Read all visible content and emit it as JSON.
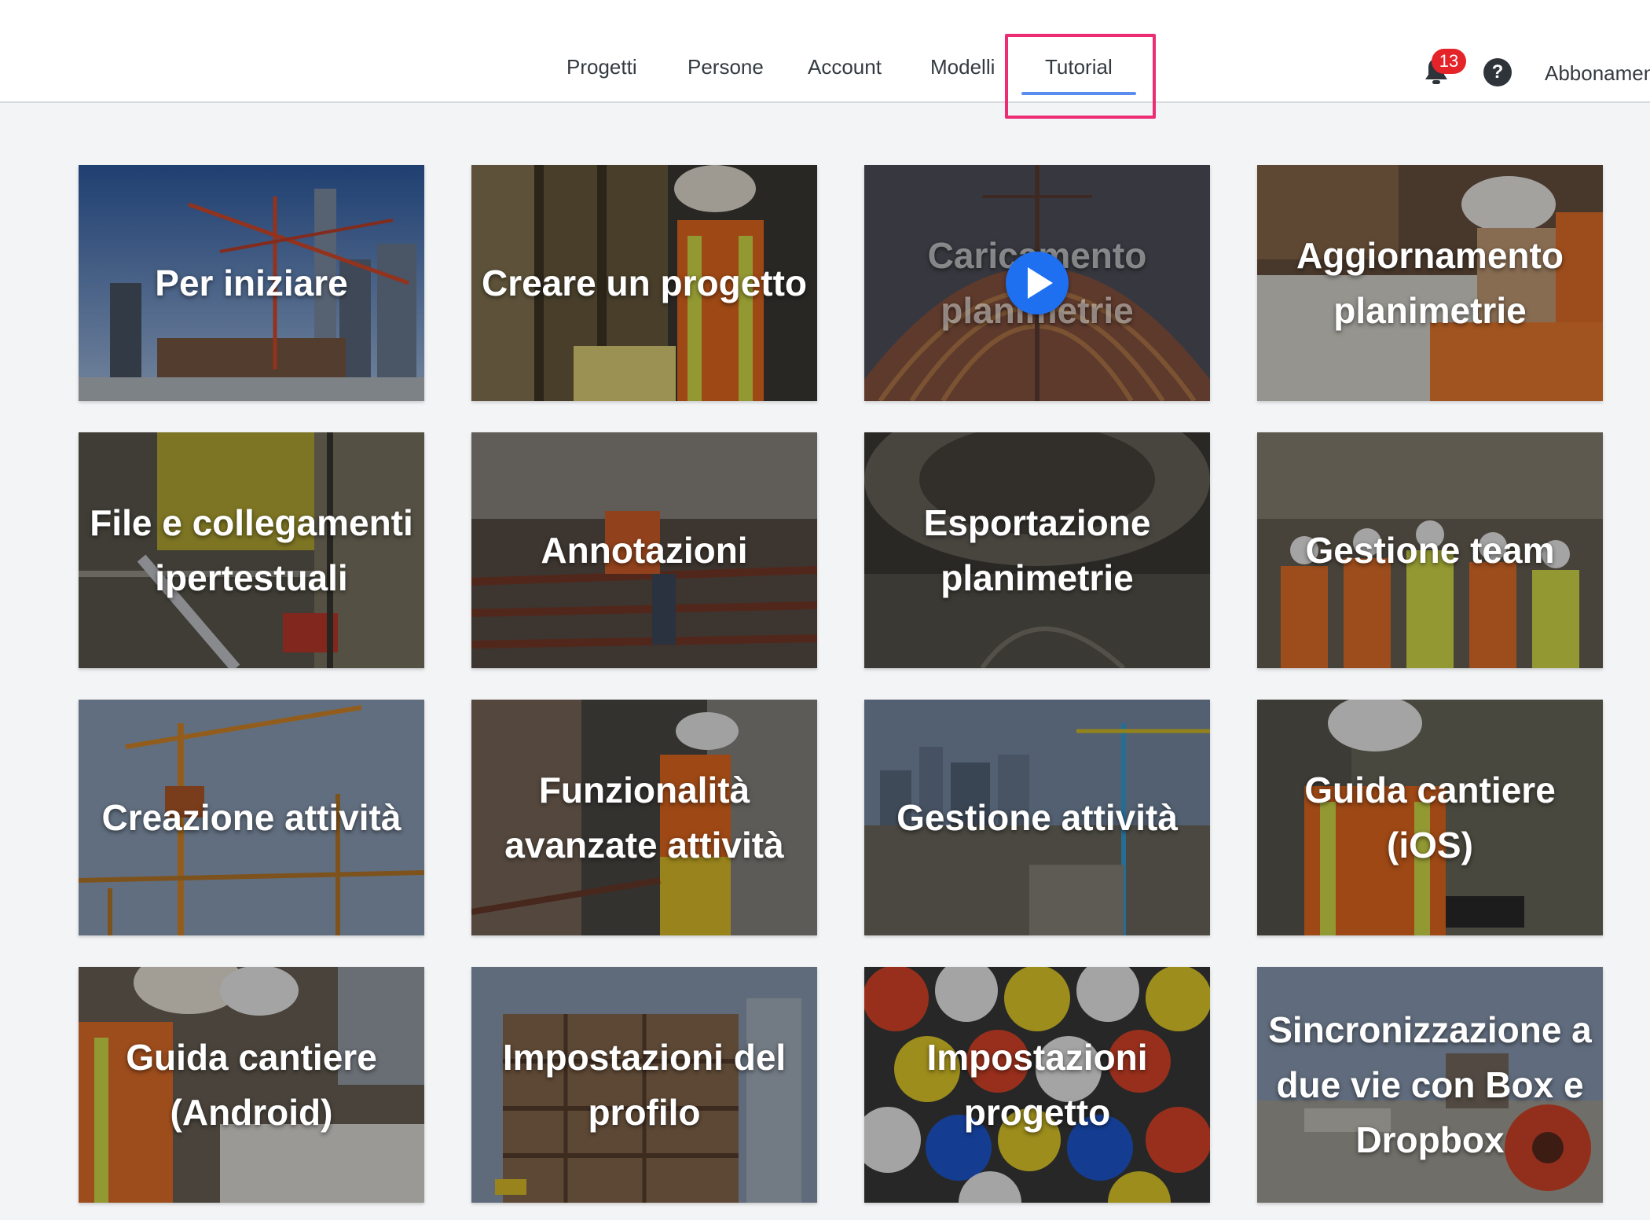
{
  "nav": {
    "tabs": [
      {
        "label": "Progetti"
      },
      {
        "label": "Persone"
      },
      {
        "label": "Account"
      },
      {
        "label": "Modelli"
      },
      {
        "label": "Tutorial",
        "active": true
      }
    ],
    "notifications_count": "13",
    "help_label": "?",
    "subscription_label": "Abbonamento"
  },
  "colors": {
    "accent": "#5b8def",
    "highlight": "#ec2d74",
    "badge": "#e5242a",
    "play_button": "#1f6ff1"
  },
  "icons": {
    "notifications": "bell-icon",
    "help": "question-mark-icon",
    "video": "play-icon"
  },
  "tutorials": [
    {
      "title": "Per iniziare"
    },
    {
      "title": "Creare un progetto"
    },
    {
      "title": "Caricamento planimetrie",
      "state": "loading"
    },
    {
      "title": "Aggiornamento planimetrie"
    },
    {
      "title": "File e collegamenti ipertestuali"
    },
    {
      "title": "Annotazioni"
    },
    {
      "title": "Esportazione planimetrie"
    },
    {
      "title": "Gestione team"
    },
    {
      "title": "Creazione attività"
    },
    {
      "title": "Funzionalità avanzate attività"
    },
    {
      "title": "Gestione attività"
    },
    {
      "title": "Guida cantiere (iOS)"
    },
    {
      "title": "Guida cantiere (Android)"
    },
    {
      "title": "Impostazioni del profilo"
    },
    {
      "title": "Impostazioni progetto"
    },
    {
      "title": "Sincronizzazione a due vie con Box e Dropbox"
    }
  ]
}
